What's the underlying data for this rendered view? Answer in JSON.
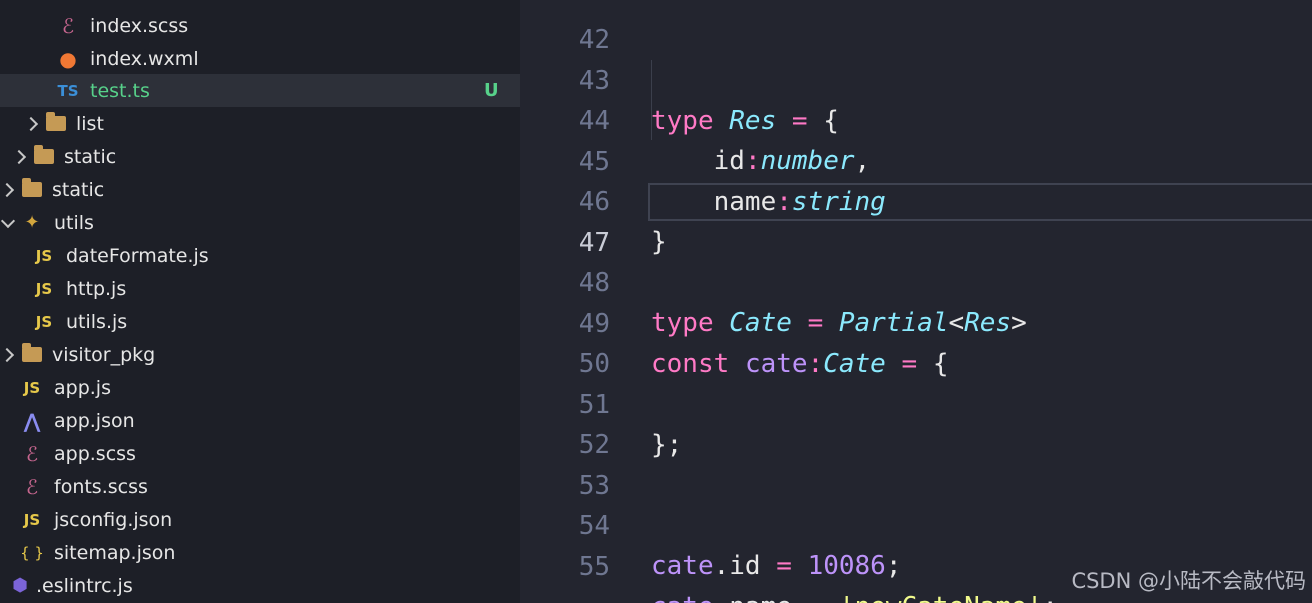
{
  "explorer": {
    "items": [
      {
        "label": "index.scss",
        "icon": "sass-icon"
      },
      {
        "label": "index.wxml",
        "icon": "wechat-icon"
      },
      {
        "label": "test.ts",
        "icon": "typescript-icon",
        "badge": "U"
      },
      {
        "label": "list",
        "icon": "folder-icon"
      },
      {
        "label": "static",
        "icon": "folder-icon"
      },
      {
        "label": "static",
        "icon": "folder-icon"
      },
      {
        "label": "utils",
        "icon": "utils-folder-icon"
      },
      {
        "label": "dateFormate.js",
        "icon": "js-icon"
      },
      {
        "label": "http.js",
        "icon": "js-icon"
      },
      {
        "label": "utils.js",
        "icon": "js-icon"
      },
      {
        "label": "visitor_pkg",
        "icon": "folder-icon"
      },
      {
        "label": "app.js",
        "icon": "js-icon"
      },
      {
        "label": "app.json",
        "icon": "json-icon"
      },
      {
        "label": "app.scss",
        "icon": "sass-icon"
      },
      {
        "label": "fonts.scss",
        "icon": "sass-icon"
      },
      {
        "label": "jsconfig.json",
        "icon": "jsconfig-icon"
      },
      {
        "label": "sitemap.json",
        "icon": "json-braces-icon"
      },
      {
        "label": ".eslintrc.js",
        "icon": "eslint-icon"
      }
    ]
  },
  "icons": {
    "js": "JS",
    "ts": "TS",
    "braces": "{ }",
    "sass": "ℰ",
    "wechat": "●",
    "json": "⋀",
    "eslint": "⬢"
  },
  "editor": {
    "line_numbers": [
      "42",
      "43",
      "44",
      "45",
      "46",
      "47",
      "48",
      "49",
      "50",
      "51",
      "52",
      "53",
      "54",
      "55"
    ],
    "current_line": "47",
    "tokens": {
      "type": "type",
      "Res": "Res",
      "eq": "=",
      "lbrace": "{",
      "rbrace": "}",
      "id": "id",
      "colon": ":",
      "number": "number",
      "comma": ",",
      "name": "name",
      "string": "string",
      "Cate": "Cate",
      "Partial": "Partial",
      "lt": "<",
      "gt": ">",
      "const": "const",
      "cate": "cate",
      "close": "};",
      "dot": ".",
      "num_val": "10086",
      "semi": ";",
      "str_val": "'newCateName'"
    }
  },
  "watermark": "CSDN @小陆不会敲代码"
}
